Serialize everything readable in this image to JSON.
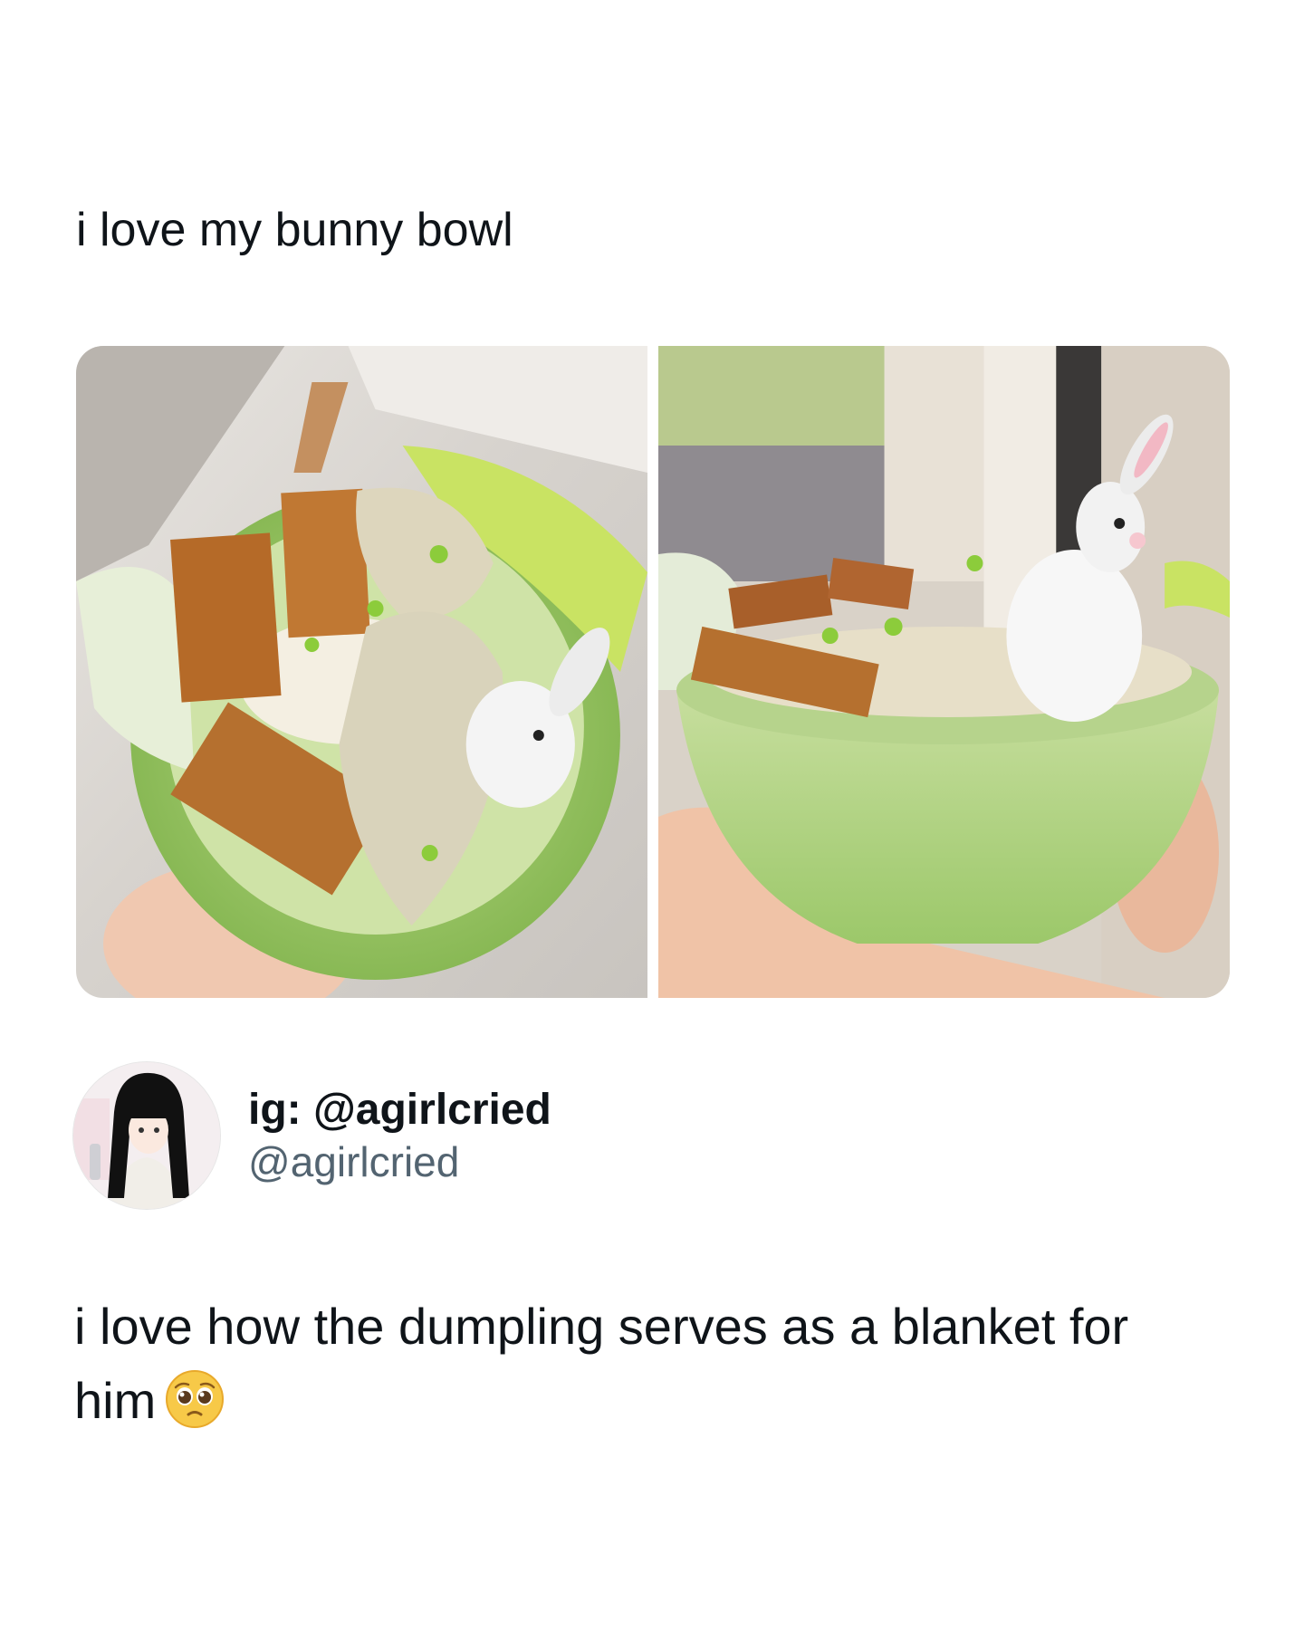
{
  "quoted_tweet": {
    "text": "i love my bunny bowl",
    "media": [
      {
        "icon": "bunny-bowl-photo-top-view"
      },
      {
        "icon": "bunny-bowl-photo-side-view"
      }
    ]
  },
  "reply": {
    "author": {
      "display_name": "ig: @agirlcried",
      "handle": "@agirlcried",
      "avatar_icon": "anime-girl-avatar"
    },
    "text": "i love how the dumpling serves as a blanket for him",
    "emoji_icon": "pleading-face-emoji"
  },
  "colors": {
    "text": "#0f1419",
    "secondary_text": "#536471",
    "bowl_green": "#9cc86a"
  }
}
